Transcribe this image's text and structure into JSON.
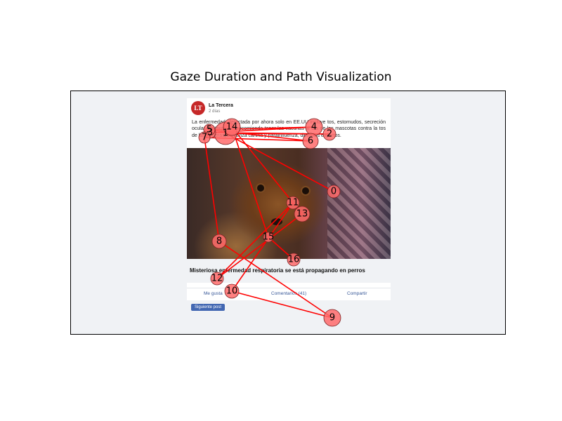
{
  "title": "Gaze Duration and Path Visualization",
  "background_post": {
    "logo_text": "LT",
    "page_name": "La Tercera",
    "post_time": "2 días",
    "body_text": "La enfermedad, detectada por ahora solo en EE.UU incluye tos, estornudos, secreción ocular y letargo. Se recomienda tener las vacunas al día de las mascotas contra la tos de las perreras, influenza canina y parainfluenza, dicen los expertos.",
    "headline": "Misteriosa enfermedad respiratoria se está propagando en perros",
    "actions": [
      "Me gusta",
      "Comentarios (41)",
      "Compartir"
    ],
    "next_button": "Siguiente post"
  },
  "chart_data": {
    "type": "scatter",
    "description_of_encoding": "",
    "x_range": [
      0,
      620
    ],
    "y_range": [
      0,
      348
    ],
    "y_inverted": true,
    "grid": false,
    "legend": "none",
    "path_color": "#ff0000",
    "marker_color": "#ff6b6b",
    "fixations": [
      {
        "id": 0,
        "x": 374,
        "y": 143,
        "size": 9
      },
      {
        "id": 1,
        "x": 220,
        "y": 60,
        "size": 16
      },
      {
        "id": 2,
        "x": 368,
        "y": 61,
        "size": 9
      },
      {
        "id": 3,
        "x": 198,
        "y": 59,
        "size": 8
      },
      {
        "id": 4,
        "x": 346,
        "y": 51,
        "size": 12
      },
      {
        "id": 5,
        "x": 197,
        "y": 55,
        "size": 8
      },
      {
        "id": 6,
        "x": 341,
        "y": 71,
        "size": 11
      },
      {
        "id": 7,
        "x": 190,
        "y": 66,
        "size": 8
      },
      {
        "id": 8,
        "x": 211,
        "y": 214,
        "size": 10
      },
      {
        "id": 9,
        "x": 372,
        "y": 323,
        "size": 12
      },
      {
        "id": 10,
        "x": 229,
        "y": 285,
        "size": 10
      },
      {
        "id": 11,
        "x": 316,
        "y": 159,
        "size": 9
      },
      {
        "id": 12,
        "x": 208,
        "y": 267,
        "size": 9
      },
      {
        "id": 13,
        "x": 329,
        "y": 175,
        "size": 11
      },
      {
        "id": 14,
        "x": 229,
        "y": 51,
        "size": 12
      },
      {
        "id": 15,
        "x": 281,
        "y": 208,
        "size": 7
      },
      {
        "id": 16,
        "x": 317,
        "y": 240,
        "size": 9
      }
    ],
    "path_order": [
      0,
      1,
      2,
      3,
      4,
      5,
      6,
      7,
      8,
      9,
      10,
      11,
      12,
      13,
      14,
      15,
      16
    ]
  }
}
